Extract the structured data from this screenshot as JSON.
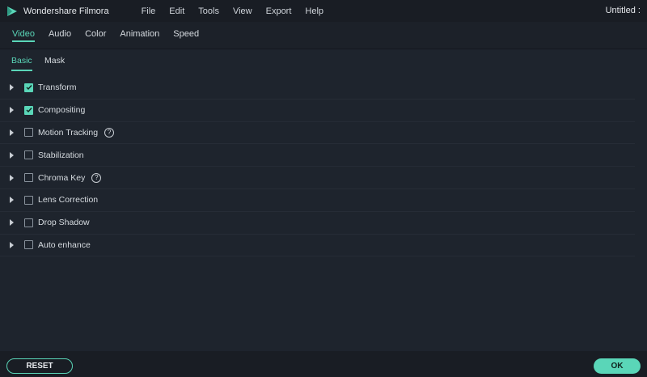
{
  "app": {
    "name": "Wondershare Filmora",
    "document_title": "Untitled :",
    "logo_icon": "filmora-logo-icon",
    "accent": "#5ad6b8"
  },
  "menu": [
    "File",
    "Edit",
    "Tools",
    "View",
    "Export",
    "Help"
  ],
  "main_tabs": [
    {
      "label": "Video",
      "active": true
    },
    {
      "label": "Audio",
      "active": false
    },
    {
      "label": "Color",
      "active": false
    },
    {
      "label": "Animation",
      "active": false
    },
    {
      "label": "Speed",
      "active": false
    }
  ],
  "sub_tabs": [
    {
      "label": "Basic",
      "active": true
    },
    {
      "label": "Mask",
      "active": false
    }
  ],
  "settings": [
    {
      "label": "Transform",
      "checked": true,
      "help": false
    },
    {
      "label": "Compositing",
      "checked": true,
      "help": false
    },
    {
      "label": "Motion Tracking",
      "checked": false,
      "help": true
    },
    {
      "label": "Stabilization",
      "checked": false,
      "help": false
    },
    {
      "label": "Chroma Key",
      "checked": false,
      "help": true
    },
    {
      "label": "Lens Correction",
      "checked": false,
      "help": false
    },
    {
      "label": "Drop Shadow",
      "checked": false,
      "help": false
    },
    {
      "label": "Auto enhance",
      "checked": false,
      "help": false
    }
  ],
  "help_glyph": "?",
  "footer": {
    "reset_label": "RESET",
    "ok_label": "OK"
  }
}
